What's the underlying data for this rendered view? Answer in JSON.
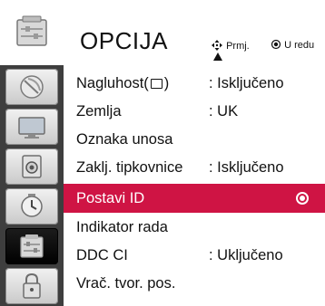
{
  "header": {
    "title": "OPCIJA",
    "hint_move": "Prmj.",
    "hint_ok": "U redu",
    "move_icon": "four-way-arrows-icon",
    "ok_icon": "ok-dot-icon"
  },
  "sidebar": {
    "items": [
      {
        "icon": "option-panel-icon",
        "state": "top"
      },
      {
        "icon": "satellite-dish-icon",
        "state": "normal"
      },
      {
        "icon": "monitor-icon",
        "state": "normal"
      },
      {
        "icon": "speaker-icon",
        "state": "normal"
      },
      {
        "icon": "clock-icon",
        "state": "normal"
      },
      {
        "icon": "option-panel-icon",
        "state": "active"
      },
      {
        "icon": "lock-icon",
        "state": "normal"
      }
    ]
  },
  "menu": {
    "items": [
      {
        "label_pre": "Nagluhost(",
        "label_post": ")",
        "has_cc": true,
        "value": ": Isključeno"
      },
      {
        "label": "Zemlja",
        "value": ": UK"
      },
      {
        "label": "Oznaka unosa",
        "value": ""
      },
      {
        "label": "Zaklj. tipkovnice",
        "value": ": Isključeno"
      },
      {
        "label": "Postavi ID",
        "value": "",
        "selected": true
      },
      {
        "label": "Indikator rada",
        "value": ""
      },
      {
        "label": "DDC CI",
        "value": ": Uključeno"
      },
      {
        "label": "Vrač. tvor. pos.",
        "value": ""
      }
    ]
  },
  "colors": {
    "selection": "#cf1444",
    "sidebar": "#3e3e3e",
    "text": "#111111"
  }
}
